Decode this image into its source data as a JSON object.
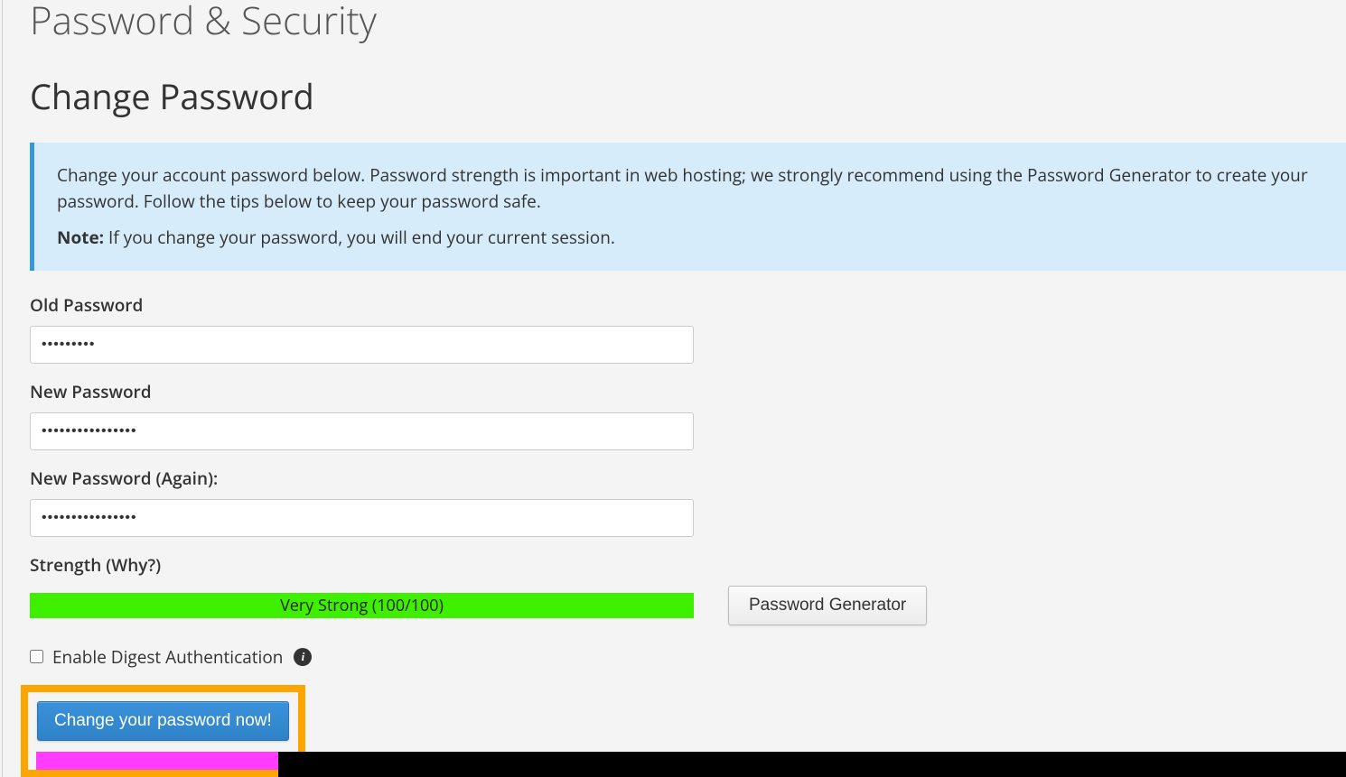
{
  "page": {
    "title": "Password & Security",
    "section_title": "Change Password"
  },
  "info": {
    "paragraph1": "Change your account password below. Password strength is important in web hosting; we strongly recommend using the Password Generator to create your password. Follow the tips below to keep your password safe.",
    "note_label": "Note:",
    "note_text": " If you change your password, you will end your current session."
  },
  "form": {
    "old_password_label": "Old Password",
    "old_password_value": "•••••••••",
    "new_password_label": "New Password",
    "new_password_value": "••••••••••••••••",
    "confirm_password_label": "New Password (Again):",
    "confirm_password_value": "••••••••••••••••",
    "strength_label": "Strength (Why?)",
    "strength_text": "Very Strong (100/100)",
    "password_generator_button": "Password Generator",
    "digest_label": "Enable Digest Authentication",
    "submit_button": "Change your password now!"
  }
}
